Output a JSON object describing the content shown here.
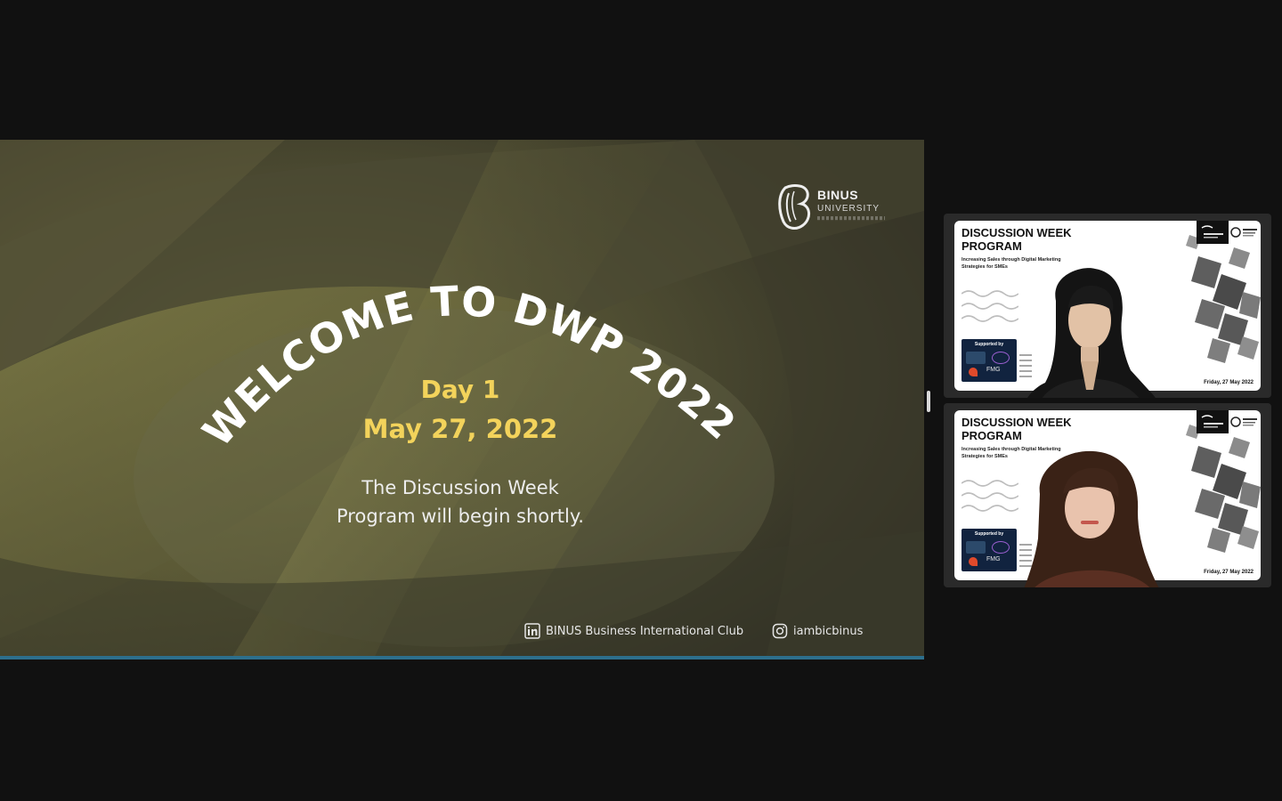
{
  "presentation": {
    "title_arc": "WELCOME TO DWP 2022",
    "day": "Day 1",
    "date": "May 27, 2022",
    "message_line1": "The Discussion Week",
    "message_line2": "Program will begin shortly.",
    "logo": {
      "brand": "BINUS",
      "sub": "UNIVERSITY"
    },
    "social": {
      "linkedin": "BINUS Business International Club",
      "instagram": "iambicbinus"
    }
  },
  "participants": [
    {
      "background": {
        "title_line1": "DISCUSSION WEEK",
        "title_line2": "PROGRAM",
        "subtitle_line1": "Increasing Sales through Digital Marketing",
        "subtitle_line2": "Strategies for SMEs",
        "supported_by": "Supported by",
        "sponsor": "FMG",
        "date": "Friday, 27 May 2022"
      }
    },
    {
      "background": {
        "title_line1": "DISCUSSION WEEK",
        "title_line2": "PROGRAM",
        "subtitle_line1": "Increasing Sales through Digital Marketing",
        "subtitle_line2": "Strategies for SMEs",
        "supported_by": "Supported by",
        "sponsor": "FMG",
        "date": "Friday, 27 May 2022"
      }
    }
  ],
  "colors": {
    "meeting_background": "#111111",
    "accent_yellow": "#f3d35b",
    "share_bottom_bar": "#2d6f8c"
  },
  "icons": [
    "linkedin-icon",
    "instagram-icon",
    "binus-logo-icon"
  ]
}
